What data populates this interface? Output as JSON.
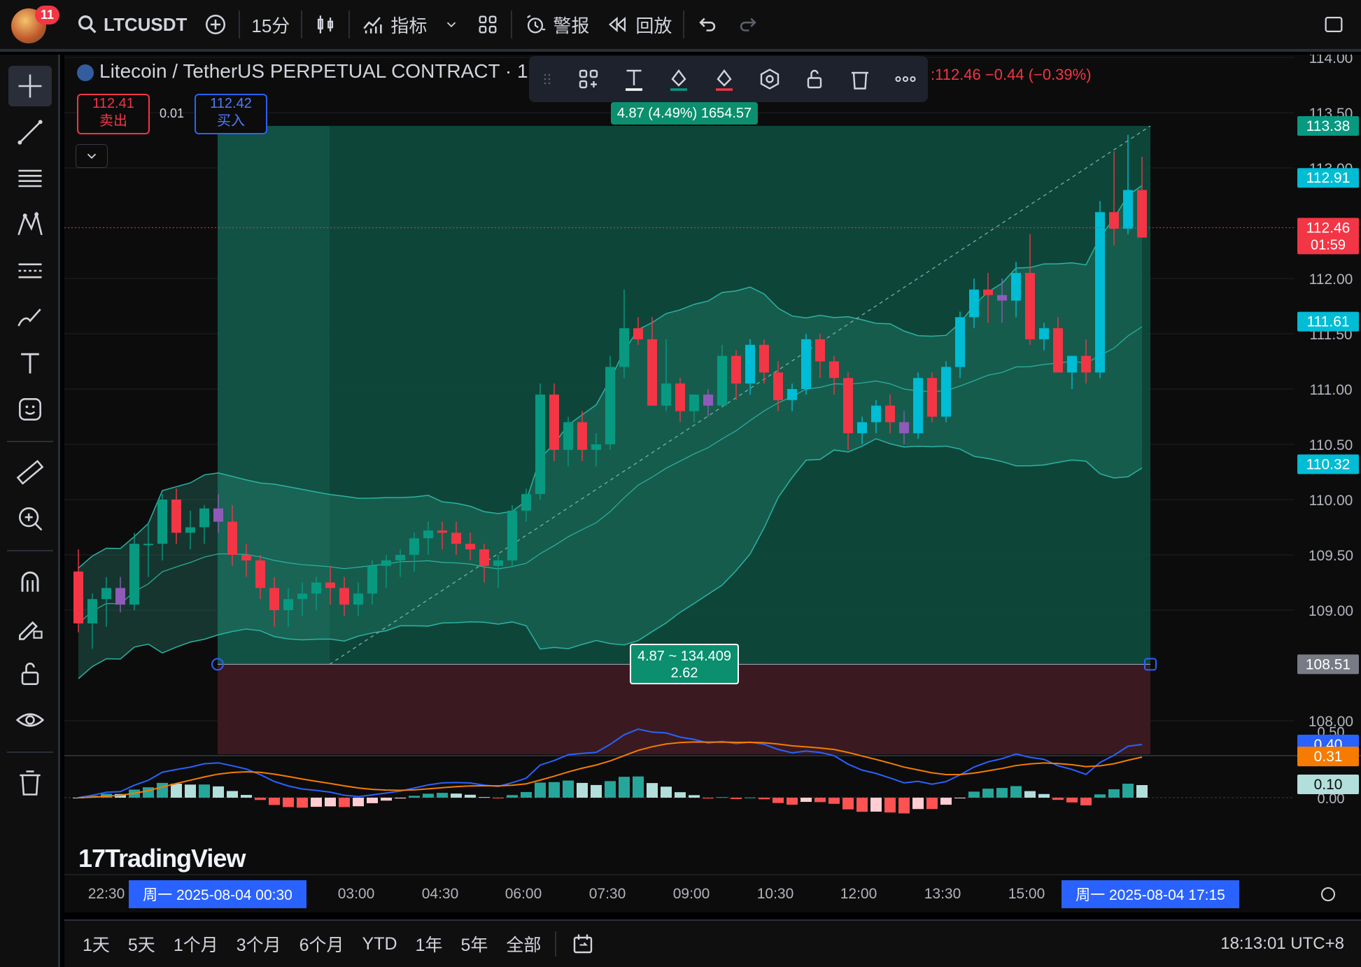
{
  "topbar": {
    "notifications": "11",
    "symbol": "LTCUSDT",
    "interval": "15分",
    "indicators_label": "指标",
    "alerts_label": "警报",
    "replay_label": "回放"
  },
  "legend": {
    "title": "Litecoin / TetherUS PERPETUAL CONTRACT · 15 ·",
    "ohlc_tail": ":112.46  −0.44 (−0.39%)",
    "sell_price": "112.41",
    "sell_label": "卖出",
    "spread": "0.01",
    "buy_price": "112.42",
    "buy_label": "买入"
  },
  "position_tool": {
    "top_label": "4.87 (4.49%) 1654.57",
    "bottom_label_line1": "4.87 ~ 134.409",
    "bottom_label_line2": "2.62"
  },
  "price_axis": {
    "ticks": [
      "114.00",
      "113.50",
      "113.00",
      "112.00",
      "111.50",
      "111.00",
      "110.50",
      "110.00",
      "109.50",
      "109.00",
      "108.00"
    ],
    "labels": [
      {
        "text": "113.38",
        "color": "#089981"
      },
      {
        "text": "112.91",
        "color": "#00bcd4"
      },
      {
        "text": "112.46",
        "text2": "01:59",
        "color": "#f23645"
      },
      {
        "text": "111.61",
        "color": "#00bcd4"
      },
      {
        "text": "110.32",
        "color": "#00bcd4"
      },
      {
        "text": "108.51",
        "color": "#787b86"
      }
    ]
  },
  "macd_axis": {
    "ticks": [
      "0.50",
      "0.00"
    ],
    "labels": [
      {
        "text": "0.40",
        "color": "#2962ff"
      },
      {
        "text": "0.31",
        "color": "#f57c00"
      },
      {
        "text": "0.10",
        "color": "#b2dfdb"
      }
    ]
  },
  "time_axis": {
    "ticks": [
      "22:30",
      "03:00",
      "04:30",
      "06:00",
      "07:30",
      "09:00",
      "10:30",
      "12:00",
      "13:30",
      "15:00"
    ],
    "start_tag": "周一 2025-08-04   00:30",
    "end_tag": "周一 2025-08-04   17:15"
  },
  "ranges": [
    "1天",
    "5天",
    "1个月",
    "3个月",
    "6个月",
    "YTD",
    "1年",
    "5年",
    "全部"
  ],
  "clock": "18:13:01 UTC+8",
  "watermark": "TradingView",
  "chart_data": {
    "type": "candlestick",
    "interval": "15分",
    "candles": [
      [
        109.35,
        109.55,
        108.8,
        108.88
      ],
      [
        108.88,
        109.15,
        108.65,
        109.1
      ],
      [
        109.1,
        109.3,
        108.85,
        109.2
      ],
      [
        109.2,
        109.3,
        108.98,
        109.05
      ],
      [
        109.05,
        109.7,
        109.0,
        109.6
      ],
      [
        109.6,
        109.8,
        109.3,
        109.6
      ],
      [
        109.6,
        110.05,
        109.45,
        110.0
      ],
      [
        110.0,
        110.1,
        109.6,
        109.7
      ],
      [
        109.7,
        109.9,
        109.55,
        109.75
      ],
      [
        109.75,
        109.95,
        109.6,
        109.92
      ],
      [
        109.92,
        110.05,
        109.7,
        109.8
      ],
      [
        109.8,
        109.95,
        109.4,
        109.5
      ],
      [
        109.5,
        109.6,
        109.3,
        109.45
      ],
      [
        109.45,
        109.5,
        109.1,
        109.2
      ],
      [
        109.2,
        109.3,
        108.85,
        109.0
      ],
      [
        109.0,
        109.2,
        108.85,
        109.1
      ],
      [
        109.1,
        109.25,
        108.95,
        109.15
      ],
      [
        109.15,
        109.3,
        109.0,
        109.25
      ],
      [
        109.25,
        109.4,
        109.05,
        109.2
      ],
      [
        109.2,
        109.3,
        108.95,
        109.05
      ],
      [
        109.05,
        109.25,
        108.95,
        109.15
      ],
      [
        109.15,
        109.45,
        109.05,
        109.4
      ],
      [
        109.4,
        109.5,
        109.2,
        109.45
      ],
      [
        109.45,
        109.55,
        109.3,
        109.5
      ],
      [
        109.5,
        109.7,
        109.35,
        109.65
      ],
      [
        109.65,
        109.8,
        109.5,
        109.72
      ],
      [
        109.72,
        109.8,
        109.55,
        109.7
      ],
      [
        109.7,
        109.8,
        109.5,
        109.6
      ],
      [
        109.6,
        109.7,
        109.45,
        109.55
      ],
      [
        109.55,
        109.6,
        109.25,
        109.4
      ],
      [
        109.4,
        109.5,
        109.2,
        109.45
      ],
      [
        109.45,
        109.95,
        109.4,
        109.9
      ],
      [
        109.9,
        110.1,
        109.8,
        110.05
      ],
      [
        110.05,
        111.05,
        110.0,
        110.95
      ],
      [
        110.95,
        111.05,
        110.35,
        110.45
      ],
      [
        110.45,
        110.75,
        110.3,
        110.7
      ],
      [
        110.7,
        110.8,
        110.35,
        110.45
      ],
      [
        110.45,
        110.6,
        110.3,
        110.5
      ],
      [
        110.5,
        111.3,
        110.45,
        111.2
      ],
      [
        111.2,
        111.9,
        111.1,
        111.55
      ],
      [
        111.55,
        111.65,
        111.4,
        111.45
      ],
      [
        111.45,
        111.65,
        110.85,
        110.85
      ],
      [
        110.85,
        111.45,
        110.8,
        111.05
      ],
      [
        111.05,
        111.1,
        110.7,
        110.8
      ],
      [
        110.8,
        110.95,
        110.7,
        110.95
      ],
      [
        110.95,
        111.0,
        110.75,
        110.85
      ],
      [
        110.85,
        111.4,
        110.85,
        111.3
      ],
      [
        111.3,
        111.35,
        110.9,
        111.05
      ],
      [
        111.05,
        111.45,
        110.95,
        111.4
      ],
      [
        111.4,
        111.45,
        111.05,
        111.15
      ],
      [
        111.15,
        111.25,
        110.8,
        110.9
      ],
      [
        110.9,
        111.05,
        110.8,
        111.0
      ],
      [
        111.0,
        111.5,
        110.95,
        111.45
      ],
      [
        111.45,
        111.5,
        111.1,
        111.25
      ],
      [
        111.25,
        111.3,
        110.95,
        111.1
      ],
      [
        111.1,
        111.15,
        110.45,
        110.6
      ],
      [
        110.6,
        110.75,
        110.5,
        110.7
      ],
      [
        110.7,
        110.9,
        110.6,
        110.85
      ],
      [
        110.85,
        110.95,
        110.6,
        110.7
      ],
      [
        110.7,
        110.8,
        110.5,
        110.6
      ],
      [
        110.6,
        111.15,
        110.55,
        111.1
      ],
      [
        111.1,
        111.15,
        110.7,
        110.75
      ],
      [
        110.75,
        111.25,
        110.7,
        111.2
      ],
      [
        111.2,
        111.7,
        111.1,
        111.65
      ],
      [
        111.65,
        112.0,
        111.55,
        111.9
      ],
      [
        111.9,
        112.05,
        111.6,
        111.85
      ],
      [
        111.85,
        112.0,
        111.6,
        111.8
      ],
      [
        111.8,
        112.15,
        111.65,
        112.05
      ],
      [
        112.05,
        112.4,
        111.4,
        111.45
      ],
      [
        111.45,
        111.6,
        111.35,
        111.55
      ],
      [
        111.55,
        111.65,
        111.25,
        111.15
      ],
      [
        111.15,
        111.3,
        111.0,
        111.3
      ],
      [
        111.3,
        111.45,
        111.05,
        111.15
      ],
      [
        111.15,
        112.7,
        111.1,
        112.6
      ],
      [
        112.6,
        113.15,
        112.3,
        112.45
      ],
      [
        112.45,
        113.3,
        112.4,
        112.8
      ],
      [
        112.8,
        113.1,
        112.4,
        112.37
      ]
    ],
    "bollinger": {
      "upper_last": 112.91,
      "basis_last": 111.61,
      "lower_last": 110.32
    },
    "position": {
      "entry": 108.51,
      "target": 113.38
    },
    "macd": {
      "macd_last": 0.4,
      "signal_last": 0.31,
      "hist_last": 0.1,
      "yticks": [
        0.5,
        0.0
      ]
    }
  }
}
